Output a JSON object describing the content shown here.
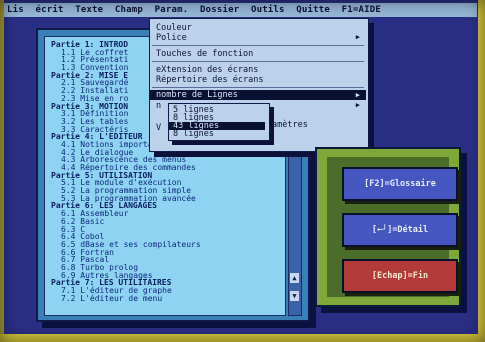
{
  "menubar": {
    "items": [
      "Lis",
      "écrit",
      "Texte",
      "Champ",
      "Param.",
      "Dossier",
      "Outils",
      "Quitte",
      "F1=AIDE"
    ]
  },
  "document": {
    "lines": [
      {
        "text": "Partie 1: INTROD",
        "type": "part"
      },
      {
        "text": "1.1 Le coffret",
        "type": "sub"
      },
      {
        "text": "1.2 Présentati",
        "type": "sub"
      },
      {
        "text": "1.3 Convention",
        "type": "sub"
      },
      {
        "text": "Partie 2: MISE E",
        "type": "part"
      },
      {
        "text": "2.1 Sauvegardé",
        "type": "sub"
      },
      {
        "text": "2.2 Installati",
        "type": "sub"
      },
      {
        "text": "2.3 Mise en ro",
        "type": "sub"
      },
      {
        "text": "Partie 3: MOTION",
        "type": "part"
      },
      {
        "text": "3.1 Définition",
        "type": "sub"
      },
      {
        "text": "3.2 Les tables",
        "type": "sub"
      },
      {
        "text": "3.3 Caractéris",
        "type": "sub"
      },
      {
        "text": "Partie 4: L'EDITEUR",
        "type": "part"
      },
      {
        "text": "4.1 Notions importa",
        "type": "sub"
      },
      {
        "text": "4.2 Le dialogue",
        "type": "sub"
      },
      {
        "text": "4.3 Arborescence des menus",
        "type": "sub"
      },
      {
        "text": "4.4 Répertoire des commandes",
        "type": "sub"
      },
      {
        "text": "Partie 5: UTILISATION",
        "type": "part"
      },
      {
        "text": "5.1 Le module d'exécution",
        "type": "sub"
      },
      {
        "text": "5.2 La programmation simple",
        "type": "sub"
      },
      {
        "text": "5.3 La programmation avancée",
        "type": "sub"
      },
      {
        "text": "Partie 6: LES LANGAGES",
        "type": "part"
      },
      {
        "text": "6.1 Assembleur",
        "type": "sub"
      },
      {
        "text": "6.2 Basic",
        "type": "sub"
      },
      {
        "text": "6.3 C",
        "type": "sub"
      },
      {
        "text": "6.4 Cobol",
        "type": "sub"
      },
      {
        "text": "6.5 dBase et ses compilateurs",
        "type": "sub"
      },
      {
        "text": "6.6 Fortran",
        "type": "sub"
      },
      {
        "text": "6.7 Pascal",
        "type": "sub"
      },
      {
        "text": "6.8 Turbo prolog",
        "type": "sub"
      },
      {
        "text": "6.9 Autres langages",
        "type": "sub"
      },
      {
        "text": "Partie 7: LES UTILITAIRES",
        "type": "part"
      },
      {
        "text": "7.1 L'éditeur de graphe",
        "type": "sub"
      },
      {
        "text": "7.2 L'éditeur de menu",
        "type": "sub"
      }
    ]
  },
  "dropdown": {
    "couleur": "Couleur",
    "police": "Police",
    "touches": "Touches de fonction",
    "extension": "eXtension des écrans",
    "repertoire": "Répertoire des écrans",
    "nombre_lignes": "nombre de Lignes",
    "n_item": "n",
    "v_item": "V"
  },
  "submenu": {
    "items": [
      "5 lignes",
      "8 lignes",
      "43 lignes",
      "8 lignes"
    ],
    "selected_index": 2
  },
  "extra_text": "amètres",
  "buttons": {
    "glossaire": "[F2]=Glossaire",
    "detail": "[←┘]=Détail",
    "fin": "[Echap]=Fin"
  }
}
